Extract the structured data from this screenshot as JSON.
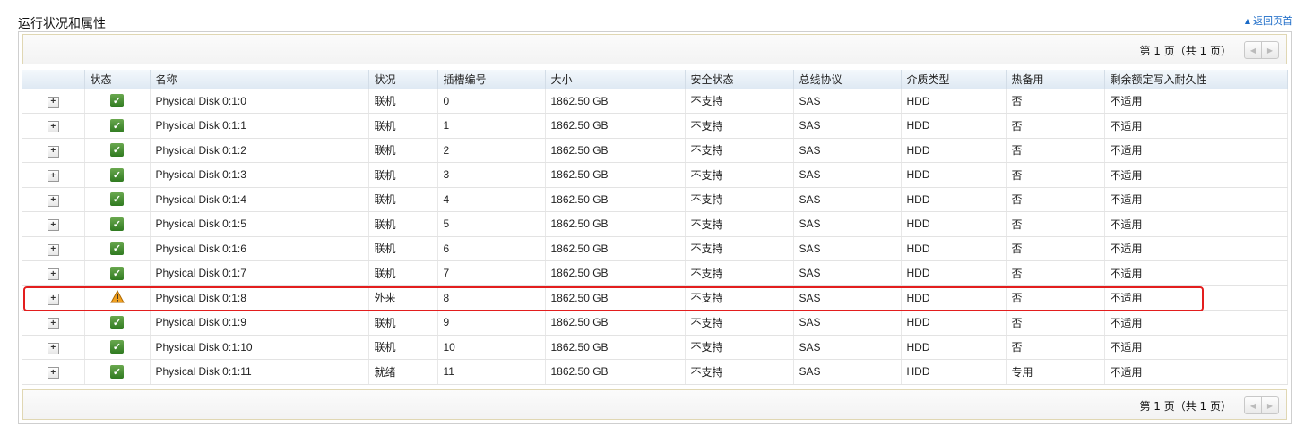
{
  "section_title": "运行状况和属性",
  "back_to_top": "返回页首",
  "pager": {
    "page_label": "第 1 页（共 1 页）"
  },
  "columns": [
    "",
    "状态",
    "名称",
    "状况",
    "插槽编号",
    "大小",
    "安全状态",
    "总线协议",
    "介质类型",
    "热备用",
    "剩余额定写入耐久性"
  ],
  "rows": [
    {
      "status": "ok",
      "name": "Physical Disk 0:1:0",
      "state": "联机",
      "slot": "0",
      "size": "1862.50 GB",
      "security": "不支持",
      "bus": "SAS",
      "media": "HDD",
      "hotspare": "否",
      "endurance": "不适用"
    },
    {
      "status": "ok",
      "name": "Physical Disk 0:1:1",
      "state": "联机",
      "slot": "1",
      "size": "1862.50 GB",
      "security": "不支持",
      "bus": "SAS",
      "media": "HDD",
      "hotspare": "否",
      "endurance": "不适用"
    },
    {
      "status": "ok",
      "name": "Physical Disk 0:1:2",
      "state": "联机",
      "slot": "2",
      "size": "1862.50 GB",
      "security": "不支持",
      "bus": "SAS",
      "media": "HDD",
      "hotspare": "否",
      "endurance": "不适用"
    },
    {
      "status": "ok",
      "name": "Physical Disk 0:1:3",
      "state": "联机",
      "slot": "3",
      "size": "1862.50 GB",
      "security": "不支持",
      "bus": "SAS",
      "media": "HDD",
      "hotspare": "否",
      "endurance": "不适用"
    },
    {
      "status": "ok",
      "name": "Physical Disk 0:1:4",
      "state": "联机",
      "slot": "4",
      "size": "1862.50 GB",
      "security": "不支持",
      "bus": "SAS",
      "media": "HDD",
      "hotspare": "否",
      "endurance": "不适用"
    },
    {
      "status": "ok",
      "name": "Physical Disk 0:1:5",
      "state": "联机",
      "slot": "5",
      "size": "1862.50 GB",
      "security": "不支持",
      "bus": "SAS",
      "media": "HDD",
      "hotspare": "否",
      "endurance": "不适用"
    },
    {
      "status": "ok",
      "name": "Physical Disk 0:1:6",
      "state": "联机",
      "slot": "6",
      "size": "1862.50 GB",
      "security": "不支持",
      "bus": "SAS",
      "media": "HDD",
      "hotspare": "否",
      "endurance": "不适用"
    },
    {
      "status": "ok",
      "name": "Physical Disk 0:1:7",
      "state": "联机",
      "slot": "7",
      "size": "1862.50 GB",
      "security": "不支持",
      "bus": "SAS",
      "media": "HDD",
      "hotspare": "否",
      "endurance": "不适用"
    },
    {
      "status": "warning",
      "name": "Physical Disk 0:1:8",
      "state": "外来",
      "slot": "8",
      "size": "1862.50 GB",
      "security": "不支持",
      "bus": "SAS",
      "media": "HDD",
      "hotspare": "否",
      "endurance": "不适用"
    },
    {
      "status": "ok",
      "name": "Physical Disk 0:1:9",
      "state": "联机",
      "slot": "9",
      "size": "1862.50 GB",
      "security": "不支持",
      "bus": "SAS",
      "media": "HDD",
      "hotspare": "否",
      "endurance": "不适用"
    },
    {
      "status": "ok",
      "name": "Physical Disk 0:1:10",
      "state": "联机",
      "slot": "10",
      "size": "1862.50 GB",
      "security": "不支持",
      "bus": "SAS",
      "media": "HDD",
      "hotspare": "否",
      "endurance": "不适用"
    },
    {
      "status": "ok",
      "name": "Physical Disk 0:1:11",
      "state": "就绪",
      "slot": "11",
      "size": "1862.50 GB",
      "security": "不支持",
      "bus": "SAS",
      "media": "HDD",
      "hotspare": "专用",
      "endurance": "不适用"
    }
  ],
  "icons": {
    "expand": "expand-plus-icon",
    "ok": "check-ok-icon",
    "warning": "warning-triangle-icon",
    "prev": "prev-page-icon",
    "next": "next-page-icon",
    "back_top": "up-arrow-icon"
  },
  "colors": {
    "ok_green": "#3c8c2c",
    "warning_orange": "#f0a020",
    "highlight_red": "#e31e1e",
    "link_blue": "#1a6ac7"
  }
}
